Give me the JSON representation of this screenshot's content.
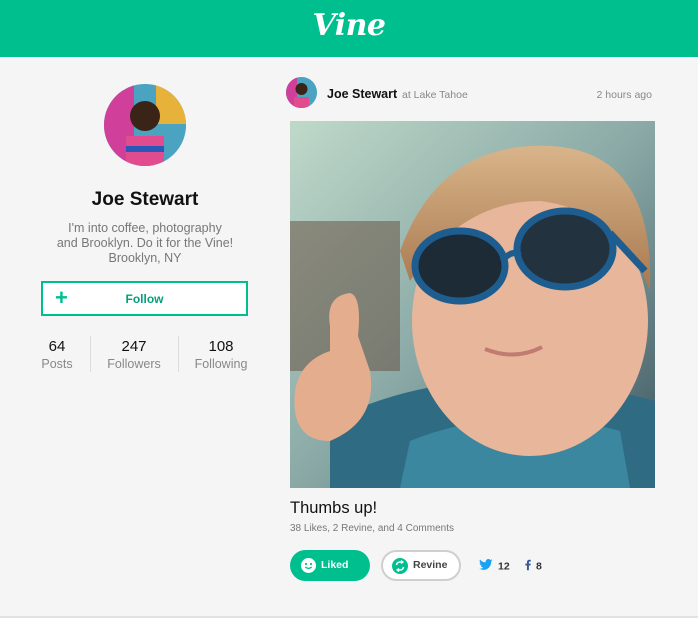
{
  "header": {
    "brand": "Vine"
  },
  "profile": {
    "name": "Joe Stewart",
    "bio_lines": [
      "I'm into coffee, photography",
      "and Brooklyn. Do it for the Vine!",
      "Brooklyn, NY"
    ],
    "follow_label": "Follow",
    "stats": [
      {
        "value": "64",
        "label": "Posts"
      },
      {
        "value": "247",
        "label": "Followers"
      },
      {
        "value": "108",
        "label": "Following"
      }
    ]
  },
  "post": {
    "author": "Joe Stewart",
    "location": "at Lake Tahoe",
    "time": "2 hours ago",
    "title": "Thumbs up!",
    "meta": "38 Likes, 2 Revine, and 4 Comments",
    "liked_label": "Liked",
    "revine_label": "Revine",
    "twitter_count": "12",
    "facebook_count": "8"
  },
  "icons": {
    "follow": "plus-icon",
    "liked": "smile-icon",
    "revine": "revine-icon",
    "twitter": "twitter-icon",
    "facebook": "facebook-icon"
  },
  "colors": {
    "accent": "#00bf8f",
    "background": "#f5f5f5",
    "text_muted": "#888888"
  }
}
